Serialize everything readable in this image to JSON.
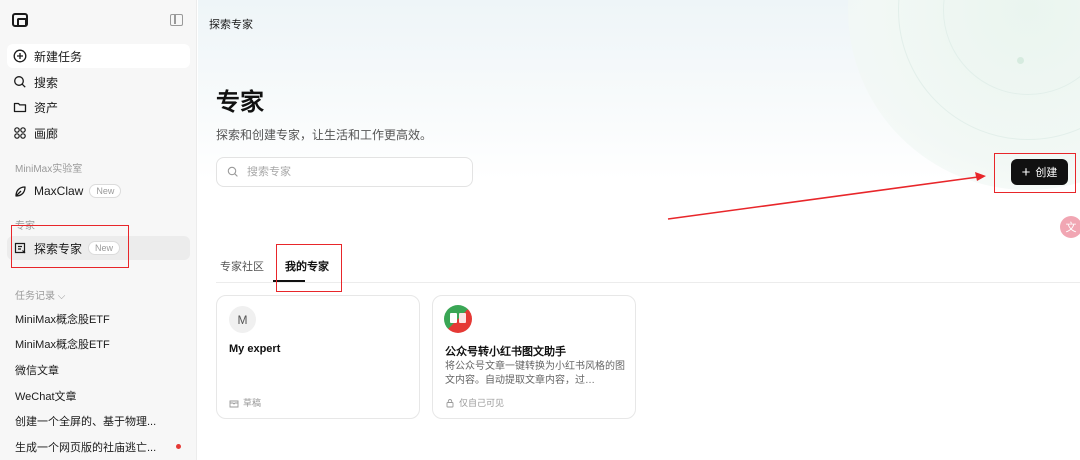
{
  "sidebar": {
    "nav": {
      "new_task": "新建任务",
      "search": "搜索",
      "assets": "资产",
      "gallery": "画廊"
    },
    "lab_section": "MiniMax实验室",
    "maxclaw": "MaxClaw",
    "new_badge": "New",
    "experts_section": "专家",
    "explore_experts": "探索专家",
    "history_section": "任务记录 ⌵",
    "history": [
      "MiniMax概念股ETF",
      "MiniMax概念股ETF",
      "微信文章",
      "WeChat文章",
      "创建一个全屏的、基于物理...",
      "生成一个网页版的社庙逃亡..."
    ]
  },
  "main": {
    "breadcrumb": "探索专家",
    "title": "专家",
    "subtitle": "探索和创建专家，让生活和工作更高效。",
    "search_placeholder": "搜索专家",
    "create_label": "创建",
    "tabs": {
      "community": "专家社区",
      "mine": "我的专家"
    },
    "cards": [
      {
        "avatar": "M",
        "title": "My expert",
        "desc": "",
        "foot": "草稿"
      },
      {
        "title": "公众号转小红书图文助手",
        "desc": "将公众号文章一键转换为小红书风格的图文内容。自动提取文章内容，过…",
        "foot": "仅自己可见"
      }
    ]
  },
  "colors": {
    "accent": "#111111",
    "annotation": "#e8262a",
    "dot": "#e53935"
  }
}
